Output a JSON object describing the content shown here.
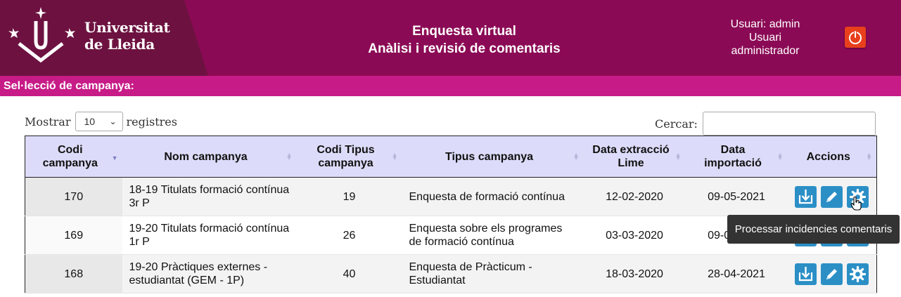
{
  "header": {
    "brand": {
      "line1": "Universitat",
      "line2": "de Lleida"
    },
    "title_line1": "Enquesta virtual",
    "title_line2": "Anàlisi i revisió de comentaris",
    "user_line1": "Usuari: admin",
    "user_line2": "Usuari",
    "user_line3": "administrador",
    "logout_icon": "power-icon"
  },
  "section": {
    "label": "Sel·lecció de campanya:"
  },
  "controls": {
    "show_label": "Mostrar",
    "page_size": "10",
    "records_label": "registres",
    "search_label": "Cercar:",
    "search_value": ""
  },
  "table": {
    "columns": [
      "Codi campanya",
      "Nom campanya",
      "Codi Tipus campanya",
      "Tipus campanya",
      "Data extracció Lime",
      "Data importació",
      "Accions"
    ],
    "sorted_column": "Codi campanya",
    "rows": [
      {
        "code": "170",
        "name": "18-19 Titulats formació contínua 3r P",
        "type_code": "19",
        "type": "Enquesta de formació contínua",
        "extraction_date": "12-02-2020",
        "import_date": "09-05-2021"
      },
      {
        "code": "169",
        "name": "19-20 Titulats formació contínua 1r P",
        "type_code": "26",
        "type": "Enquesta sobre els programes de formació contínua",
        "extraction_date": "03-03-2020",
        "import_date": "09-05-2021"
      },
      {
        "code": "168",
        "name": "19-20 Pràctiques externes - estudiantat (GEM - 1P)",
        "type_code": "40",
        "type": "Enquesta de Pràcticum - Estudiantat",
        "extraction_date": "18-03-2020",
        "import_date": "28-04-2021"
      }
    ],
    "action_icons": [
      "download-icon",
      "pencil-icon",
      "gear-icon"
    ]
  },
  "tooltip": {
    "text": "Processar incidencies comentaris"
  },
  "colors": {
    "header_bg": "#8b0a55",
    "logo_panel_bg": "#6d1240",
    "section_bar_bg": "#c71b87",
    "table_header_bg": "#dcdcfa",
    "action_button_bg": "#2b8fc6",
    "logout_bg": "#e8401c",
    "tooltip_bg": "#333333"
  }
}
